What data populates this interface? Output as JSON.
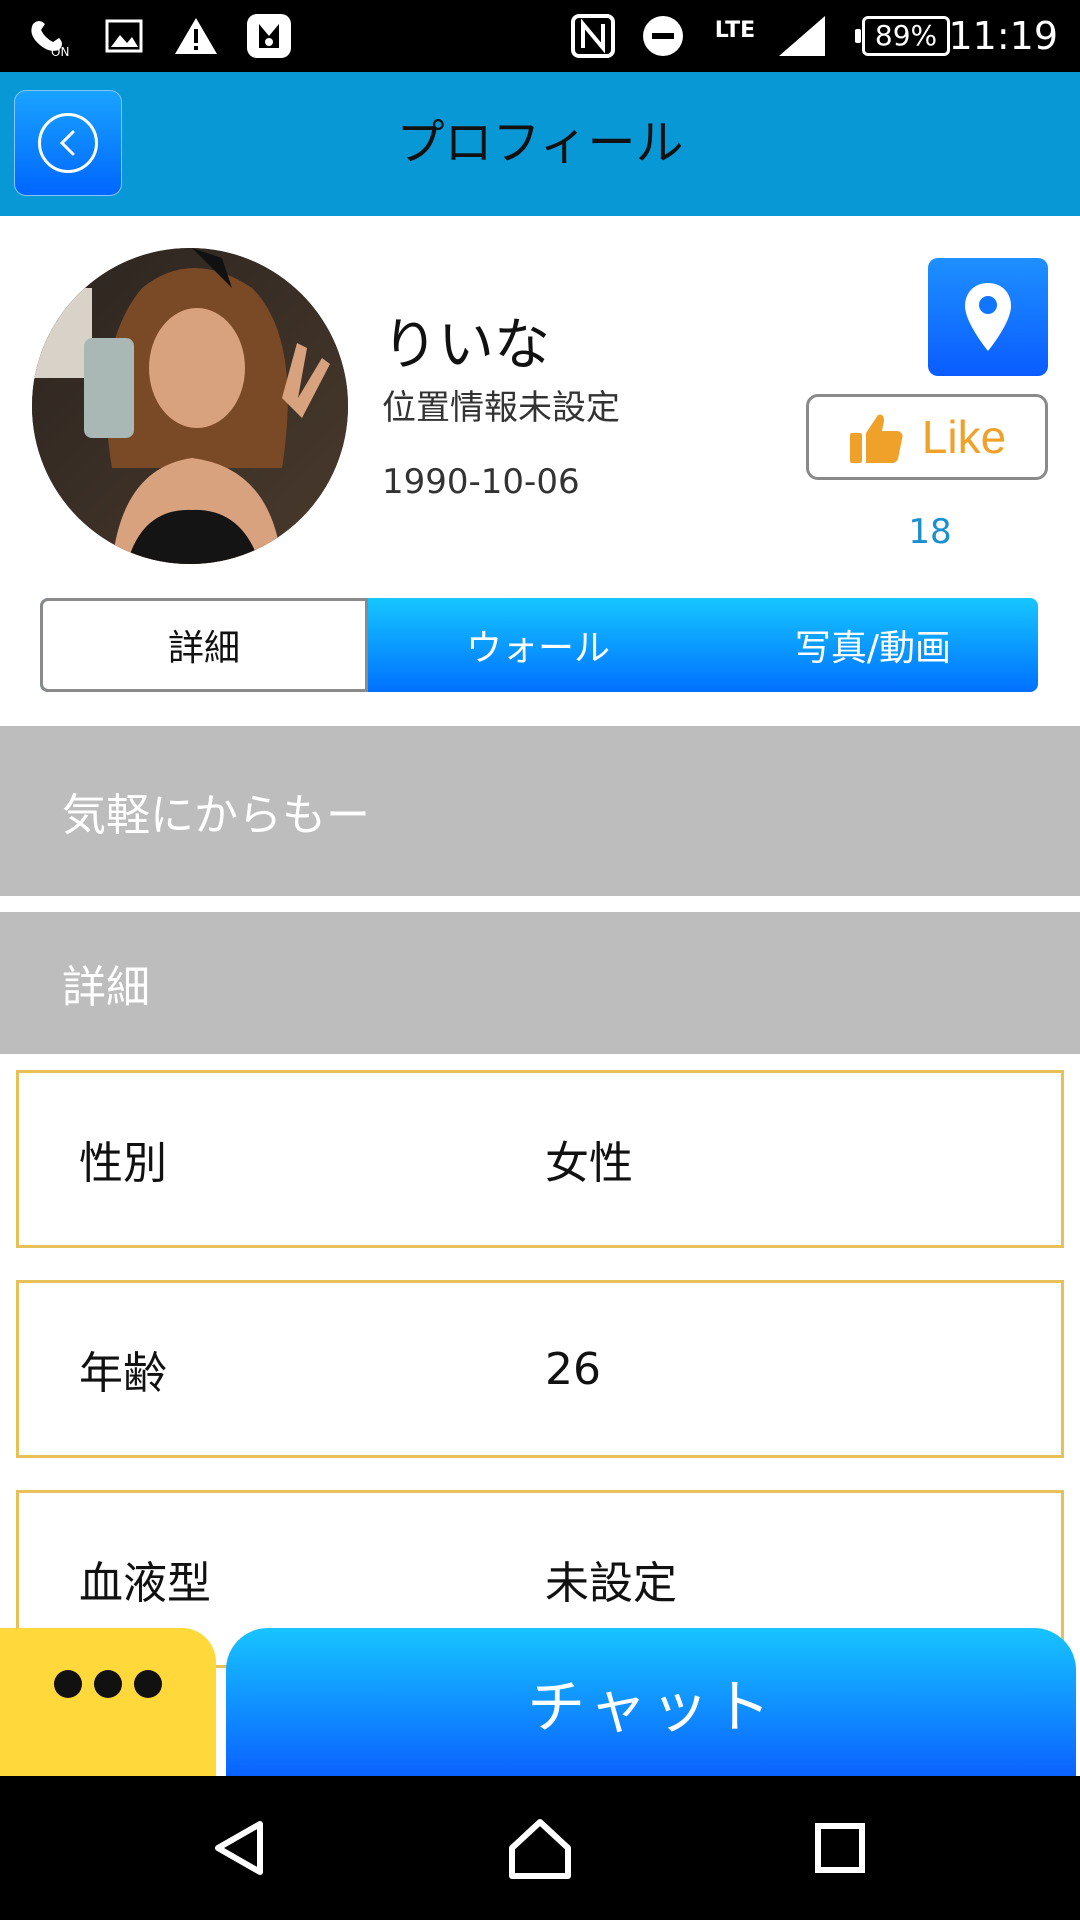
{
  "status_bar": {
    "time": "11:19",
    "battery": "89%",
    "network": "LTE",
    "icons": [
      "wifi-calling-icon",
      "image-icon",
      "warning-icon",
      "app-icon",
      "nfc-icon",
      "do-not-disturb-icon",
      "signal-icon",
      "battery-icon"
    ]
  },
  "header": {
    "title": "プロフィール",
    "back_icon": "chevron-left-icon"
  },
  "profile": {
    "name": "りいな",
    "location": "位置情報未設定",
    "birthdate": "1990-10-06",
    "like_label": "Like",
    "like_count": "18",
    "location_icon": "map-pin-icon",
    "like_icon": "thumbs-up-icon"
  },
  "tabs": [
    {
      "label": "詳細",
      "active": true
    },
    {
      "label": "ウォール",
      "active": false
    },
    {
      "label": "写真/動画",
      "active": false
    }
  ],
  "bio": "気軽にからもー",
  "detail_section": {
    "title": "詳細",
    "rows": [
      {
        "label": "性別",
        "value": "女性"
      },
      {
        "label": "年齢",
        "value": "26"
      },
      {
        "label": "血液型",
        "value": "未設定"
      }
    ]
  },
  "actions": {
    "more_icon": "more-dots-icon",
    "chat_label": "チャット"
  },
  "nav": {
    "back": "nav-back-icon",
    "home": "nav-home-icon",
    "recents": "nav-recents-icon"
  },
  "colors": {
    "header_bg": "#0898d6",
    "accent_blue": "#0a62ff",
    "row_border": "#e8c05a",
    "gray_block": "#bdbdbd",
    "more_button": "#ffd83b",
    "like_text": "#f0a12a"
  }
}
